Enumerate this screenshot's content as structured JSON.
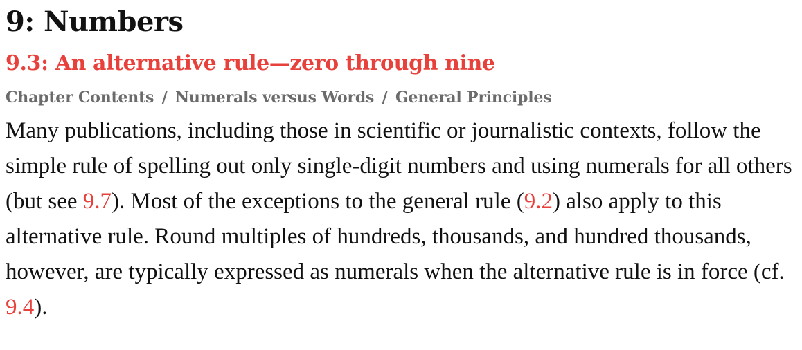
{
  "chapter": {
    "title": "9: Numbers"
  },
  "section": {
    "title": "9.3: An alternative rule—zero through nine"
  },
  "breadcrumb": {
    "items": [
      "Chapter Contents",
      "Numerals versus Words",
      "General Principles"
    ],
    "separator": "/"
  },
  "paragraph": {
    "text_1": "Many publications, including those in scientific or journalistic contexts, follow the simple rule of spelling out only single-digit numbers and using numerals for all others (but see ",
    "link_1": "9.7",
    "text_2": "). Most of the exceptions to the general rule (",
    "link_2": "9.2",
    "text_3": ") also apply to this alternative rule. Round multiples of hundreds, thousands, and hundred thousands, however, are typically expressed as numerals when the alternative rule is in force (cf. ",
    "link_3": "9.4",
    "text_4": ")."
  },
  "colors": {
    "accent": "#e8403a",
    "breadcrumb": "#6b6b6b",
    "text": "#111111"
  }
}
